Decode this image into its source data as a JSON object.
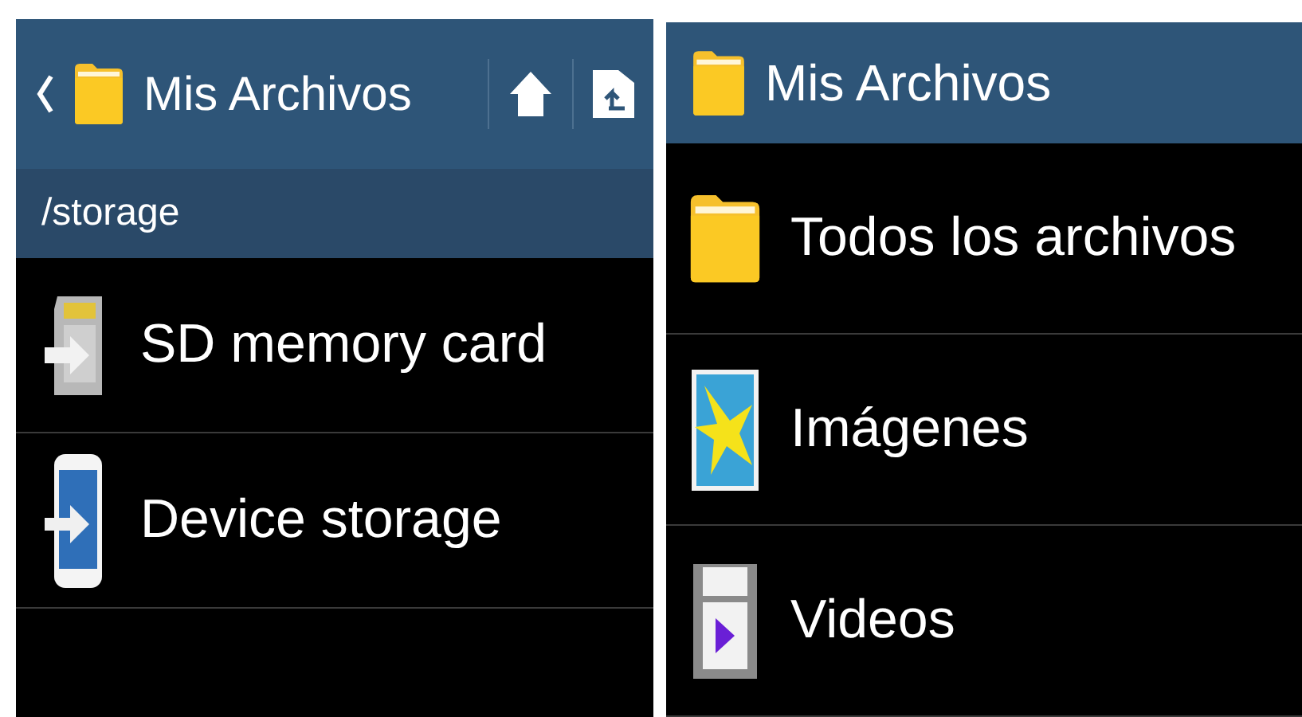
{
  "left_screen": {
    "title": "Mis Archivos",
    "path": "/storage",
    "items": [
      {
        "kind": "sd",
        "label": "SD memory card"
      },
      {
        "kind": "device",
        "label": "Device storage"
      }
    ]
  },
  "right_screen": {
    "title": "Mis Archivos",
    "items": [
      {
        "kind": "folder",
        "label": "Todos los archivos"
      },
      {
        "kind": "images",
        "label": "Imágenes"
      },
      {
        "kind": "videos",
        "label": "Videos"
      }
    ]
  }
}
